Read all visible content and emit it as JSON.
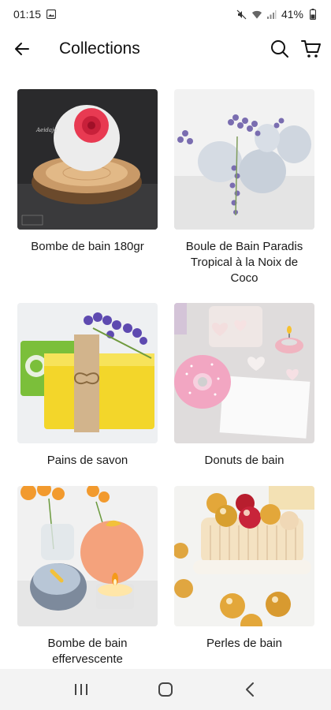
{
  "status": {
    "time": "01:15",
    "battery": "41%"
  },
  "header": {
    "title": "Collections",
    "back_icon": "arrow-left-icon",
    "search_icon": "search-icon",
    "cart_icon": "cart-icon"
  },
  "collections": [
    {
      "label": "Bombe de bain 180gr"
    },
    {
      "label": "Boule de Bain Paradis Tropical à la Noix de Coco"
    },
    {
      "label": "Pains de savon"
    },
    {
      "label": "Donuts de bain"
    },
    {
      "label": "Bombe de bain effervescente"
    },
    {
      "label": "Perles de bain"
    }
  ],
  "nav": {
    "recents_icon": "recents-icon",
    "home_icon": "home-icon",
    "back_icon": "back-chevron-icon"
  }
}
